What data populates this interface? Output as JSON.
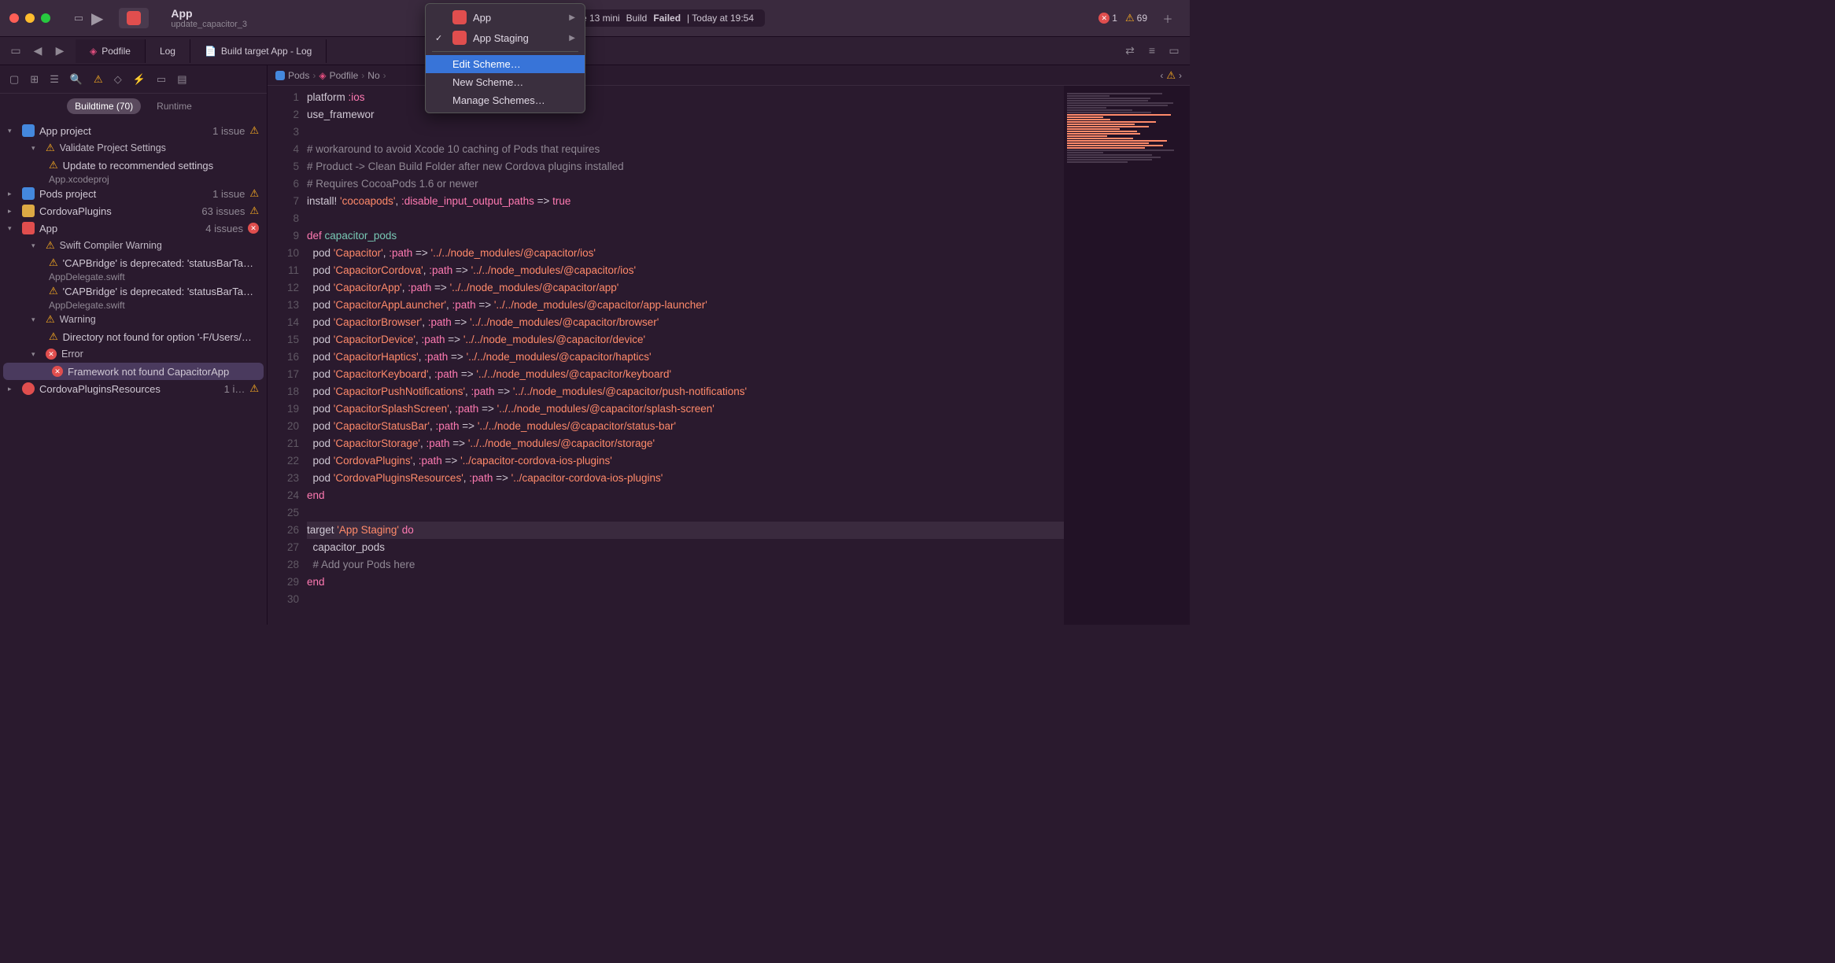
{
  "titlebar": {
    "app_name": "App",
    "app_subtitle": "update_capacitor_3",
    "device": "ne 13 mini",
    "build_status": "Build",
    "build_result": "Failed",
    "build_time": "| Today at 19:54",
    "error_count": "1",
    "warning_count": "69"
  },
  "scheme_menu": {
    "items": [
      {
        "label": "App",
        "checked": false,
        "arrow": true
      },
      {
        "label": "App Staging",
        "checked": true,
        "arrow": true
      }
    ],
    "actions": [
      {
        "label": "Edit Scheme…",
        "highlighted": true
      },
      {
        "label": "New Scheme…",
        "highlighted": false
      },
      {
        "label": "Manage Schemes…",
        "highlighted": false
      }
    ]
  },
  "tabs": [
    {
      "label": "Podfile",
      "icon": "gem",
      "active": true
    },
    {
      "label": "Log",
      "partial": true
    },
    {
      "label": "Build target App - Log",
      "icon": "doc"
    }
  ],
  "sidebar": {
    "filter": {
      "buildtime": "Buildtime (70)",
      "runtime": "Runtime"
    },
    "items": [
      {
        "name": "App project",
        "count": "1 issue",
        "icon": "proj-blue",
        "expanded": true,
        "warn": true
      },
      {
        "name": "Validate Project Settings",
        "sub": true,
        "expanded": true,
        "warn_prefix": true
      },
      {
        "name": "Update to recommended settings",
        "detail": true,
        "warn_prefix": true
      },
      {
        "file": "App.xcodeproj"
      },
      {
        "name": "Pods project",
        "count": "1 issue",
        "icon": "proj-blue",
        "warn": true
      },
      {
        "name": "CordovaPlugins",
        "count": "63 issues",
        "icon": "proj-yellow",
        "warn": true
      },
      {
        "name": "App",
        "count": "4 issues",
        "icon": "proj-red",
        "expanded": true,
        "error": true
      },
      {
        "name": "Swift Compiler Warning",
        "sub": true,
        "expanded": true,
        "warn_prefix": true
      },
      {
        "name": "'CAPBridge' is deprecated: 'statusBarTappedNotification' has been moved to Notific…",
        "detail": true,
        "warn_prefix": true
      },
      {
        "file": "AppDelegate.swift"
      },
      {
        "name": "'CAPBridge' is deprecated: 'statusBarTappedNotification' has been moved to Notific…",
        "detail": true,
        "warn_prefix": true
      },
      {
        "file": "AppDelegate.swift"
      },
      {
        "name": "Warning",
        "sub": true,
        "expanded": true,
        "warn_prefix": true
      },
      {
        "name": "Directory not found for option '-F/Users/████/Library/Developer/Xcode/D…",
        "detail": true,
        "warn_prefix": true
      },
      {
        "name": "Error",
        "sub": true,
        "expanded": true,
        "err_prefix": true
      },
      {
        "name": "Framework not found CapacitorApp",
        "detail": true,
        "err_prefix": true,
        "selected": true
      },
      {
        "name": "CordovaPluginsResources",
        "count": "1 i…",
        "icon": "proj-target",
        "warn": true
      }
    ]
  },
  "breadcrumb": [
    {
      "label": "Pods",
      "icon": "proj"
    },
    {
      "label": "Podfile",
      "icon": "gem"
    },
    {
      "label": "No",
      "partial": true
    }
  ],
  "code": {
    "lines": [
      {
        "n": 1,
        "tokens": [
          [
            "",
            "platform "
          ],
          [
            "kw",
            ":ios"
          ]
        ],
        "clipped": true
      },
      {
        "n": 2,
        "tokens": [
          [
            "",
            "use_framewor"
          ]
        ],
        "clipped": true
      },
      {
        "n": 3,
        "tokens": [
          [
            "",
            ""
          ]
        ]
      },
      {
        "n": 4,
        "tokens": [
          [
            "cmt",
            "# workaround to avoid Xcode 10 caching of Pods that requires"
          ]
        ]
      },
      {
        "n": 5,
        "tokens": [
          [
            "cmt",
            "# Product -> Clean Build Folder after new Cordova plugins installed"
          ]
        ]
      },
      {
        "n": 6,
        "tokens": [
          [
            "cmt",
            "# Requires CocoaPods 1.6 or newer"
          ]
        ]
      },
      {
        "n": 7,
        "tokens": [
          [
            "",
            "install! "
          ],
          [
            "str",
            "'cocoapods'"
          ],
          [
            "",
            ", "
          ],
          [
            "kw",
            ":disable_input_output_paths"
          ],
          [
            "",
            " => "
          ],
          [
            "bool",
            "true"
          ]
        ]
      },
      {
        "n": 8,
        "tokens": [
          [
            "",
            ""
          ]
        ]
      },
      {
        "n": 9,
        "tokens": [
          [
            "kw",
            "def"
          ],
          [
            "",
            " "
          ],
          [
            "fn",
            "capacitor_pods"
          ]
        ]
      },
      {
        "n": 10,
        "tokens": [
          [
            "",
            "  pod "
          ],
          [
            "str",
            "'Capacitor'"
          ],
          [
            "",
            ", "
          ],
          [
            "kw",
            ":path"
          ],
          [
            "",
            " => "
          ],
          [
            "str",
            "'../../node_modules/@capacitor/ios'"
          ]
        ]
      },
      {
        "n": 11,
        "tokens": [
          [
            "",
            "  pod "
          ],
          [
            "str",
            "'CapacitorCordova'"
          ],
          [
            "",
            ", "
          ],
          [
            "kw",
            ":path"
          ],
          [
            "",
            " => "
          ],
          [
            "str",
            "'../../node_modules/@capacitor/ios'"
          ]
        ]
      },
      {
        "n": 12,
        "tokens": [
          [
            "",
            "  pod "
          ],
          [
            "str",
            "'CapacitorApp'"
          ],
          [
            "",
            ", "
          ],
          [
            "kw",
            ":path"
          ],
          [
            "",
            " => "
          ],
          [
            "str",
            "'../../node_modules/@capacitor/app'"
          ]
        ]
      },
      {
        "n": 13,
        "tokens": [
          [
            "",
            "  pod "
          ],
          [
            "str",
            "'CapacitorAppLauncher'"
          ],
          [
            "",
            ", "
          ],
          [
            "kw",
            ":path"
          ],
          [
            "",
            " => "
          ],
          [
            "str",
            "'../../node_modules/@capacitor/app-launcher'"
          ]
        ]
      },
      {
        "n": 14,
        "tokens": [
          [
            "",
            "  pod "
          ],
          [
            "str",
            "'CapacitorBrowser'"
          ],
          [
            "",
            ", "
          ],
          [
            "kw",
            ":path"
          ],
          [
            "",
            " => "
          ],
          [
            "str",
            "'../../node_modules/@capacitor/browser'"
          ]
        ]
      },
      {
        "n": 15,
        "tokens": [
          [
            "",
            "  pod "
          ],
          [
            "str",
            "'CapacitorDevice'"
          ],
          [
            "",
            ", "
          ],
          [
            "kw",
            ":path"
          ],
          [
            "",
            " => "
          ],
          [
            "str",
            "'../../node_modules/@capacitor/device'"
          ]
        ]
      },
      {
        "n": 16,
        "tokens": [
          [
            "",
            "  pod "
          ],
          [
            "str",
            "'CapacitorHaptics'"
          ],
          [
            "",
            ", "
          ],
          [
            "kw",
            ":path"
          ],
          [
            "",
            " => "
          ],
          [
            "str",
            "'../../node_modules/@capacitor/haptics'"
          ]
        ]
      },
      {
        "n": 17,
        "tokens": [
          [
            "",
            "  pod "
          ],
          [
            "str",
            "'CapacitorKeyboard'"
          ],
          [
            "",
            ", "
          ],
          [
            "kw",
            ":path"
          ],
          [
            "",
            " => "
          ],
          [
            "str",
            "'../../node_modules/@capacitor/keyboard'"
          ]
        ]
      },
      {
        "n": 18,
        "tokens": [
          [
            "",
            "  pod "
          ],
          [
            "str",
            "'CapacitorPushNotifications'"
          ],
          [
            "",
            ", "
          ],
          [
            "kw",
            ":path"
          ],
          [
            "",
            " => "
          ],
          [
            "str",
            "'../../node_modules/@capacitor/push-notifications'"
          ]
        ]
      },
      {
        "n": 19,
        "tokens": [
          [
            "",
            "  pod "
          ],
          [
            "str",
            "'CapacitorSplashScreen'"
          ],
          [
            "",
            ", "
          ],
          [
            "kw",
            ":path"
          ],
          [
            "",
            " => "
          ],
          [
            "str",
            "'../../node_modules/@capacitor/splash-screen'"
          ]
        ]
      },
      {
        "n": 20,
        "tokens": [
          [
            "",
            "  pod "
          ],
          [
            "str",
            "'CapacitorStatusBar'"
          ],
          [
            "",
            ", "
          ],
          [
            "kw",
            ":path"
          ],
          [
            "",
            " => "
          ],
          [
            "str",
            "'../../node_modules/@capacitor/status-bar'"
          ]
        ]
      },
      {
        "n": 21,
        "tokens": [
          [
            "",
            "  pod "
          ],
          [
            "str",
            "'CapacitorStorage'"
          ],
          [
            "",
            ", "
          ],
          [
            "kw",
            ":path"
          ],
          [
            "",
            " => "
          ],
          [
            "str",
            "'../../node_modules/@capacitor/storage'"
          ]
        ]
      },
      {
        "n": 22,
        "tokens": [
          [
            "",
            "  pod "
          ],
          [
            "str",
            "'CordovaPlugins'"
          ],
          [
            "",
            ", "
          ],
          [
            "kw",
            ":path"
          ],
          [
            "",
            " => "
          ],
          [
            "str",
            "'../capacitor-cordova-ios-plugins'"
          ]
        ]
      },
      {
        "n": 23,
        "tokens": [
          [
            "",
            "  pod "
          ],
          [
            "str",
            "'CordovaPluginsResources'"
          ],
          [
            "",
            ", "
          ],
          [
            "kw",
            ":path"
          ],
          [
            "",
            " => "
          ],
          [
            "str",
            "'../capacitor-cordova-ios-plugins'"
          ]
        ]
      },
      {
        "n": 24,
        "tokens": [
          [
            "kw",
            "end"
          ]
        ]
      },
      {
        "n": 25,
        "tokens": [
          [
            "",
            ""
          ]
        ]
      },
      {
        "n": 26,
        "tokens": [
          [
            "",
            "target "
          ],
          [
            "str",
            "'App Staging'"
          ],
          [
            "",
            " "
          ],
          [
            "kw",
            "do"
          ]
        ],
        "hl": true
      },
      {
        "n": 27,
        "tokens": [
          [
            "",
            "  capacitor_pods"
          ]
        ]
      },
      {
        "n": 28,
        "tokens": [
          [
            "",
            "  "
          ],
          [
            "cmt",
            "# Add your Pods here"
          ]
        ]
      },
      {
        "n": 29,
        "tokens": [
          [
            "kw",
            "end"
          ]
        ]
      },
      {
        "n": 30,
        "tokens": [
          [
            "",
            ""
          ]
        ]
      }
    ]
  }
}
